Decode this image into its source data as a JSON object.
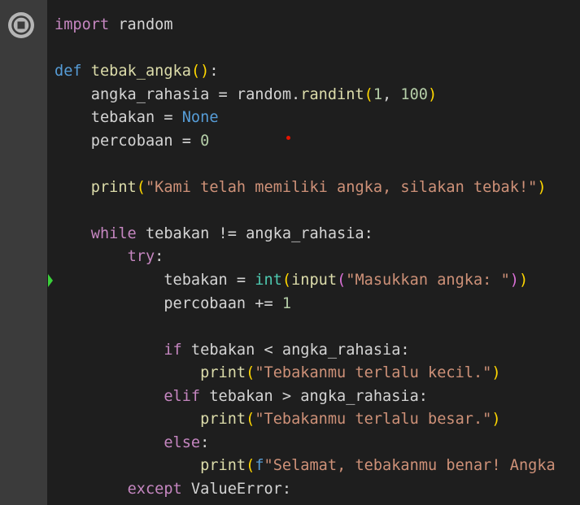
{
  "icons": {
    "run_button": "stop-circle-icon",
    "gutter_marker": "execution-arrow-icon",
    "breakpoint_dot": "red-dot-icon"
  },
  "colors": {
    "gutter": "#3b3b3b",
    "background": "#1e1e1e",
    "keyword_blue": "#569cd6",
    "keyword_purple": "#c586c0",
    "function": "#dcdcaa",
    "string": "#ce9178",
    "number": "#b5cea8",
    "bracket": "#ffd700",
    "bracket_inner": "#da70d6",
    "marker": "#3ad13a"
  },
  "code": {
    "l1": {
      "kw": "import",
      "rest": " random"
    },
    "l3": {
      "kw": "def",
      "sp": " ",
      "fn": "tebak_angka",
      "open": "(",
      "close": ")",
      "colon": ":"
    },
    "l4": {
      "a": "    angka_rahasia = random.",
      "fn": "randint",
      "open": "(",
      "n1": "1",
      "comma": ", ",
      "n2": "100",
      "close": ")"
    },
    "l5": {
      "a": "    tebakan = ",
      "kw": "None"
    },
    "l6": {
      "a": "    percobaan = ",
      "n": "0"
    },
    "l8": {
      "ind": "    ",
      "fn": "print",
      "open": "(",
      "s": "\"Kami telah memiliki angka, silakan tebak!\"",
      "close": ")"
    },
    "l10": {
      "ind": "    ",
      "kw": "while",
      "rest": " tebakan != angka_rahasia:"
    },
    "l11": {
      "ind": "        ",
      "kw": "try",
      "colon": ":"
    },
    "l12": {
      "a": "            tebakan = ",
      "fn": "int",
      "open": "(",
      "fn2": "input",
      "open2": "(",
      "s": "\"Masukkan angka: \"",
      "close2": ")",
      "close": ")"
    },
    "l13": {
      "a": "            percobaan += ",
      "n": "1"
    },
    "l15": {
      "ind": "            ",
      "kw": "if",
      "rest": " tebakan < angka_rahasia:"
    },
    "l16": {
      "ind": "                ",
      "fn": "print",
      "open": "(",
      "s": "\"Tebakanmu terlalu kecil.\"",
      "close": ")"
    },
    "l17": {
      "ind": "            ",
      "kw": "elif",
      "rest": " tebakan > angka_rahasia:"
    },
    "l18": {
      "ind": "                ",
      "fn": "print",
      "open": "(",
      "s": "\"Tebakanmu terlalu besar.\"",
      "close": ")"
    },
    "l19": {
      "ind": "            ",
      "kw": "else",
      "colon": ":"
    },
    "l20": {
      "ind": "                ",
      "fn": "print",
      "open": "(",
      "f": "f",
      "s": "\"Selamat, tebakanmu benar! Angka"
    },
    "l21": {
      "ind": "        ",
      "kw": "except",
      "rest": " ValueError:"
    }
  }
}
